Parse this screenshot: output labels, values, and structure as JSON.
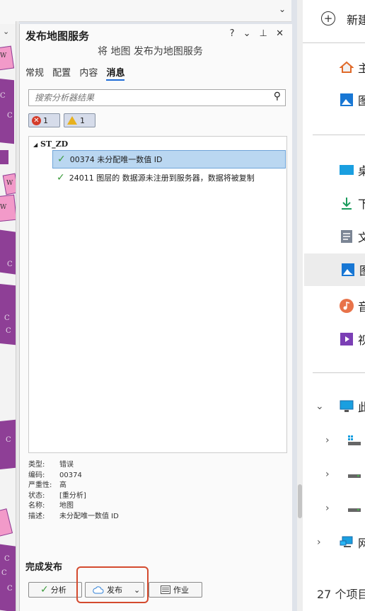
{
  "panel": {
    "title": "发布地图服务",
    "subtitle": "将 地图 发布为地图服务",
    "header_buttons": "? ⌄ ⊥ ✕",
    "tabs": [
      {
        "label": "常规",
        "active": false
      },
      {
        "label": "配置",
        "active": false
      },
      {
        "label": "内容",
        "active": false
      },
      {
        "label": "消息",
        "active": true
      }
    ],
    "search_placeholder": "搜索分析器结果",
    "errors_count": "1",
    "warnings_count": "1",
    "tree_root": "ST_ZD",
    "messages": [
      {
        "code": "00374",
        "text": "00374 未分配唯一数值 ID",
        "selected": true
      },
      {
        "code": "24011",
        "text": "24011 图层的  数据源未注册到服务器，数据将被复制",
        "selected": false
      }
    ],
    "details": [
      {
        "k": "类型:",
        "v": "错误"
      },
      {
        "k": "编码:",
        "v": "00374"
      },
      {
        "k": "严重性:",
        "v": "高"
      },
      {
        "k": "状态:",
        "v": "[重分析]"
      },
      {
        "k": "名称:",
        "v": "地图"
      },
      {
        "k": "描述:",
        "v": "未分配唯一数值 ID"
      }
    ],
    "footer_title": "完成发布",
    "buttons": {
      "analyze": "分析",
      "publish": "发布",
      "job": "作业"
    }
  },
  "map_labels": [
    "W",
    "C",
    "C",
    "W",
    "W",
    "C",
    "C",
    "C",
    "C",
    "C",
    "C",
    "C"
  ],
  "explorer": {
    "new_label": "新建",
    "items": [
      "主",
      "图",
      "桌",
      "下",
      "文",
      "图",
      "音",
      "视"
    ],
    "tree": [
      "此",
      "",
      "",
      "",
      "网"
    ],
    "footer": "27 个项目"
  },
  "colors": {
    "accent": "#1f6bd6",
    "highlight": "#d44a2e",
    "map_purple": "#8e3f96",
    "map_pink": "#f29ac9"
  }
}
